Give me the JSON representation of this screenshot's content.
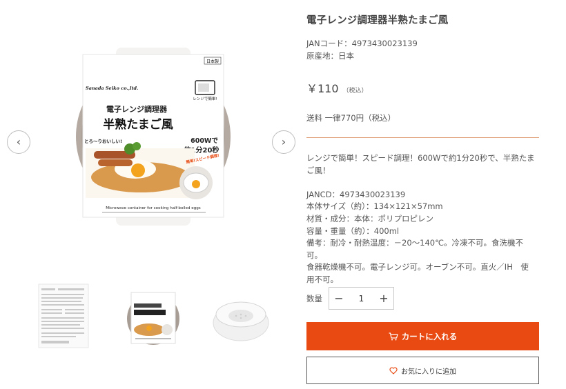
{
  "product": {
    "title": "電子レンジ調理器半熟たまご風",
    "jan": "JANコード：4973430023139",
    "origin": "原産地：日本",
    "price": "￥110",
    "tax_note": "（税込）",
    "shipping": "送料 一律770円（税込）"
  },
  "description": {
    "lead_1": "レンジで簡単！スピード調理！600Wで約1分20秒で、半熟たま",
    "lead_2": "ご風！",
    "specs": [
      "JANCD：4973430023139",
      "本体サイズ（約）：134×121×57mm",
      "材質・成分：本体：ポリプロピレン",
      "容量・重量（約）：400ml",
      "備考：耐冷・耐熱温度：－20〜140℃。冷凍不可。食洗機不可。",
      "食器乾燥機不可。電子レンジ可。オーブン不可。直火／IH　使",
      "用不可。"
    ]
  },
  "package": {
    "brand": "Sanada Seiko co.,ltd.",
    "made_in": "日本製",
    "name_small": "電子レンジ調理器",
    "name_large": "半熟たまご風",
    "microwave_badge": "レンジで簡単!",
    "time_1": "600Wで",
    "time_2": "約1分20秒",
    "tagline": "とろ～りおいしい!",
    "speed_badge": "簡単!スピード調理!",
    "english": "Microwave container for cooking half-boiled eggs"
  },
  "purchase": {
    "qty_label": "数量",
    "qty_value": "1",
    "minus": "−",
    "plus": "+",
    "cart_label": "カートに入れる",
    "fav_label": "お気に入りに追加"
  },
  "gallery": {
    "prev": "‹",
    "next": "›"
  },
  "colors": {
    "accent": "#e84a12",
    "divider": "#e0a07a"
  }
}
